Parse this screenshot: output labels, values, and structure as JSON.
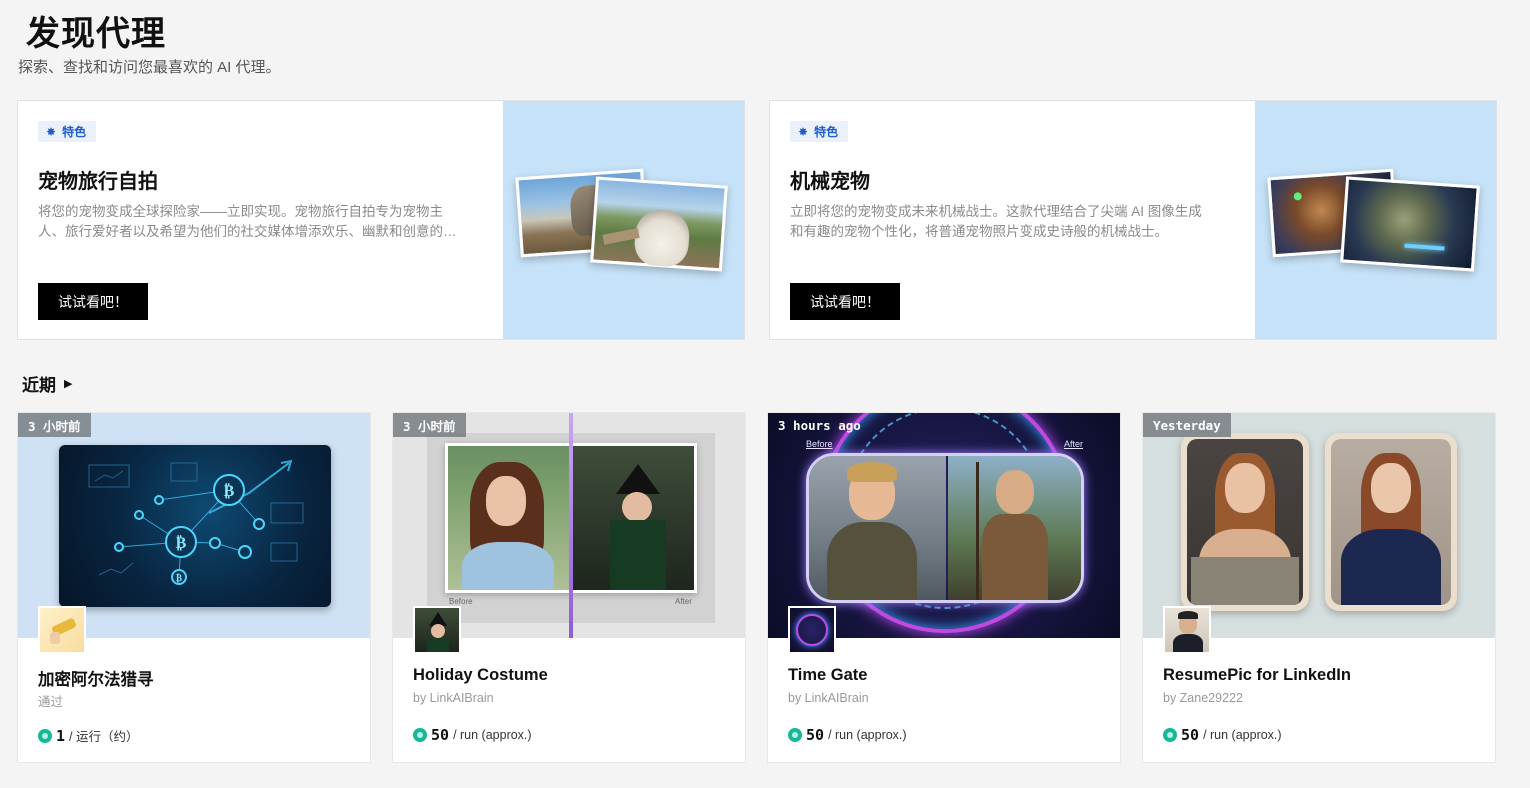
{
  "header": {
    "title": "发现代理",
    "subtitle": "探索、查找和访问您最喜欢的 AI 代理。"
  },
  "featured": [
    {
      "tag": "特色",
      "title": "宠物旅行自拍",
      "description": "将您的宠物变成全球探险家——立即实现。宠物旅行自拍专为宠物主人、旅行爱好者以及希望为他们的社交媒体增添欢乐、幽默和创意的人设计。",
      "button": "试试看吧！"
    },
    {
      "tag": "特色",
      "title": "机械宠物",
      "description": "立即将您的宠物变成未来机械战士。这款代理结合了尖端 AI 图像生成和有趣的宠物个性化，将普通宠物照片变成史诗般的机械战士。",
      "button": "试试看吧！"
    }
  ],
  "recent": {
    "title": "近期",
    "cards": [
      {
        "time": "3 小时前",
        "title": "加密阿尔法猎寻",
        "author": "通过",
        "price": "1",
        "unit": "/ 运行（约）"
      },
      {
        "time": "3 小时前",
        "title": "Holiday Costume",
        "author": "by LinkAIBrain",
        "price": "50",
        "unit": "/ run (approx.)",
        "before_label": "Before",
        "after_label": "After"
      },
      {
        "time": "3 hours ago",
        "title": "Time Gate",
        "author": "by LinkAIBrain",
        "price": "50",
        "unit": "/ run (approx.)",
        "before_label": "Before",
        "after_label": "After"
      },
      {
        "time": "Yesterday",
        "title": "ResumePic for LinkedIn",
        "author": "by Zane29222",
        "price": "50",
        "unit": "/ run (approx.)"
      }
    ]
  },
  "colors": {
    "featured_art_bg": "#c6e2f8",
    "tag_bg": "#eaf1fb",
    "tag_text": "#1f5fc9",
    "coin": "#17b897"
  }
}
